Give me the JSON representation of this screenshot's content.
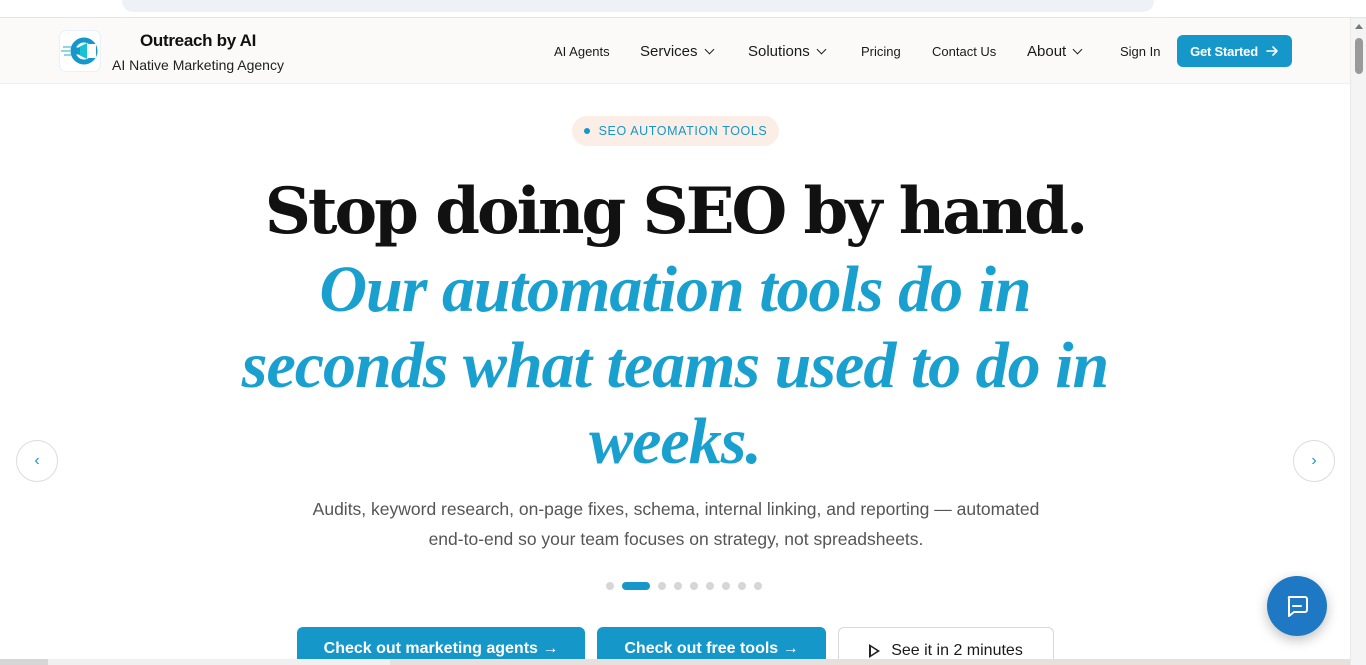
{
  "header": {
    "brand_name": "Outreach by AI",
    "brand_tagline": "AI Native Marketing Agency",
    "nav": {
      "ai_agents": "AI Agents",
      "services": "Services",
      "solutions": "Solutions",
      "pricing": "Pricing",
      "contact": "Contact Us",
      "about": "About",
      "sign_in": "Sign In"
    },
    "cta_label": "Get Started"
  },
  "hero": {
    "badge": "SEO AUTOMATION TOOLS",
    "headline": "Stop doing SEO by hand.",
    "subline": "Our automation tools do in seconds what teams used to do in weeks.",
    "description": "Audits, keyword research, on-page fixes, schema, internal linking, and reporting — automated end-to-end so your team focuses on strategy, not spreadsheets.",
    "prev_glyph": "‹",
    "next_glyph": "›",
    "active_slide": 2,
    "slide_count": 9,
    "buttons": {
      "agents": "Check out marketing agents →",
      "tools": "Check out free tools →",
      "video": "See it in 2 minutes"
    }
  },
  "colors": {
    "accent": "#1697c9",
    "headline": "#111111",
    "subline": "#1aa0cf",
    "badge_bg": "#fbeee6",
    "chat_button": "#1f78c4"
  },
  "icons": {
    "logo": "megaphone-c-logo-icon",
    "cta_arrow": "arrow-right-icon",
    "chat": "chat-bubble-icon",
    "play": "play-icon",
    "dropdown": "chevron-down-icon"
  }
}
